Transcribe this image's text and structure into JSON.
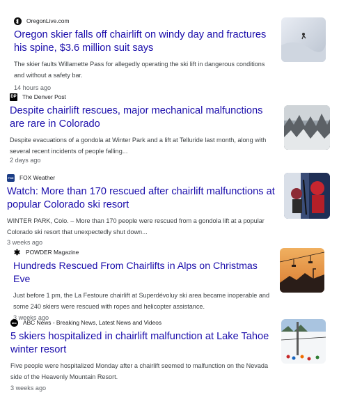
{
  "articles": [
    {
      "source": "OregonLive.com",
      "title": "Oregon skier falls off chairlift on windy day and fractures his spine, $3.6 million suit says",
      "snippet": "The skier faults Willamette Pass for allegedly operating the ski lift in dangerous conditions and without a safety bar.",
      "time": "14 hours ago",
      "favicon_icon": "oregonlive-icon"
    },
    {
      "source": "The Denver Post",
      "title": "Despite chairlift rescues, major mechanical malfunctions are rare in Colorado",
      "snippet": "Despite evacuations of a gondola at Winter Park and a lift at Telluride last month, along with several recent incidents of people falling...",
      "time": "2 days ago",
      "favicon_icon": "denver-post-icon"
    },
    {
      "source": "FOX Weather",
      "title": "Watch: More than 170 rescued after chairlift malfunctions at popular Colorado ski resort",
      "snippet": "WINTER PARK, Colo. – More than 170 people were rescued from a gondola lift at a popular Colorado ski resort that unexpectedly shut down...",
      "time": "3 weeks ago",
      "favicon_icon": "fox-weather-icon"
    },
    {
      "source": "POWDER Magazine",
      "title": "Hundreds Rescued From Chairlifts in Alps on Christmas Eve",
      "snippet": "Just before 1 pm, the La Festoure chairlift at Superdévoluy ski area became inoperable and some 240 skiers were rescued with ropes and helicopter assistance.",
      "time": "3 weeks ago",
      "favicon_icon": "asterisk-icon"
    },
    {
      "source": "ABC News - Breaking News, Latest News and Videos",
      "title": "5 skiers hospitalized in chairlift malfunction at Lake Tahoe winter resort",
      "snippet": "Five people were hospitalized Monday after a chairlift seemed to malfunction on the Nevada side of the Heavenly Mountain Resort.",
      "time": "3 weeks ago",
      "favicon_icon": "abc-news-icon"
    }
  ],
  "favicon_text": {
    "denver_post": "DP",
    "fox_weather": "FOX",
    "powder": "✱",
    "abc": "abc"
  },
  "colors": {
    "link": "#1a0dab",
    "snippet": "#3c4043",
    "meta": "#5f6368"
  }
}
